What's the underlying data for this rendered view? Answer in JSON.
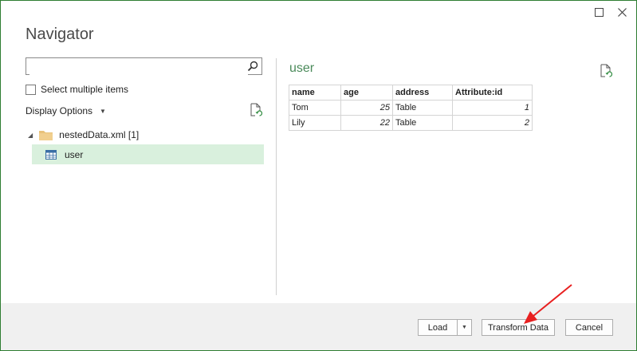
{
  "window": {
    "title": "Navigator"
  },
  "left": {
    "search": {
      "value": "",
      "placeholder": ""
    },
    "select_multiple_label": "Select multiple items",
    "display_options_label": "Display Options",
    "tree": {
      "folder_label": "nestedData.xml [1]",
      "items": [
        {
          "label": "user",
          "selected": true
        }
      ]
    }
  },
  "preview": {
    "title": "user",
    "columns": [
      "name",
      "age",
      "address",
      "Attribute:id"
    ],
    "rows": [
      {
        "name": "Tom",
        "age": "25",
        "address": "Table",
        "id": "1"
      },
      {
        "name": "Lily",
        "age": "22",
        "address": "Table",
        "id": "2"
      }
    ]
  },
  "footer": {
    "load_label": "Load",
    "transform_label": "Transform Data",
    "cancel_label": "Cancel"
  },
  "colors": {
    "selection": "#d9f0dd",
    "accent_green": "#4a8a5a",
    "annotation_arrow": "#e82020"
  }
}
